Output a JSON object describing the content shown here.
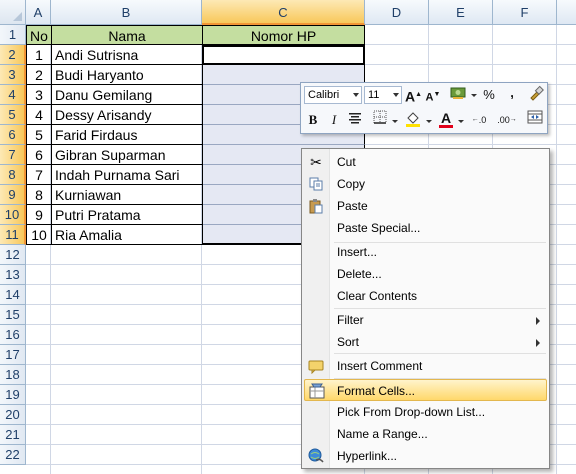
{
  "columns": [
    "A",
    "B",
    "C",
    "D",
    "E",
    "F"
  ],
  "rows": [
    "1",
    "2",
    "3",
    "4",
    "5",
    "6",
    "7",
    "8",
    "9",
    "10",
    "11",
    "12",
    "13",
    "14",
    "15",
    "16",
    "17",
    "18",
    "19",
    "20",
    "21",
    "22"
  ],
  "table": {
    "headers": {
      "no": "No",
      "nama": "Nama",
      "hp": "Nomor HP"
    },
    "data": [
      {
        "no": "1",
        "nama": "Andi Sutrisna"
      },
      {
        "no": "2",
        "nama": "Budi Haryanto"
      },
      {
        "no": "3",
        "nama": "Danu Gemilang"
      },
      {
        "no": "4",
        "nama": "Dessy Arisandy"
      },
      {
        "no": "5",
        "nama": "Farid Firdaus"
      },
      {
        "no": "6",
        "nama": "Gibran Suparman"
      },
      {
        "no": "7",
        "nama": "Indah Purnama Sari"
      },
      {
        "no": "8",
        "nama": "Kurniawan"
      },
      {
        "no": "9",
        "nama": "Putri Pratama"
      },
      {
        "no": "10",
        "nama": "Ria Amalia"
      }
    ]
  },
  "mini_toolbar": {
    "font": "Calibri",
    "size": "11",
    "grow_font": "A",
    "shrink_font": "A",
    "percent": "%",
    "comma": ",",
    "bold": "B",
    "italic": "I",
    "font_color_letter": "A",
    "inc_decimal": ".0",
    "dec_decimal": ".00"
  },
  "context_menu": {
    "items": [
      {
        "label": "Cut",
        "icon": "scissors-icon"
      },
      {
        "label": "Copy",
        "icon": "copy-icon"
      },
      {
        "label": "Paste",
        "icon": "paste-icon"
      },
      {
        "label": "Paste Special..."
      },
      {
        "label": "Insert..."
      },
      {
        "label": "Delete..."
      },
      {
        "label": "Clear Contents"
      },
      {
        "label": "Filter",
        "submenu": true
      },
      {
        "label": "Sort",
        "submenu": true
      },
      {
        "label": "Insert Comment",
        "icon": "comment-icon"
      },
      {
        "label": "Format Cells...",
        "icon": "format-cells-icon",
        "highlighted": true
      },
      {
        "label": "Pick From Drop-down List..."
      },
      {
        "label": "Name a Range..."
      },
      {
        "label": "Hyperlink...",
        "icon": "hyperlink-icon"
      }
    ]
  },
  "colors": {
    "header_fill": "#c4dea0",
    "selection_fill": "#e5e8f3",
    "highlight": "#ffd86b",
    "selected_header": "#f8c85b"
  }
}
